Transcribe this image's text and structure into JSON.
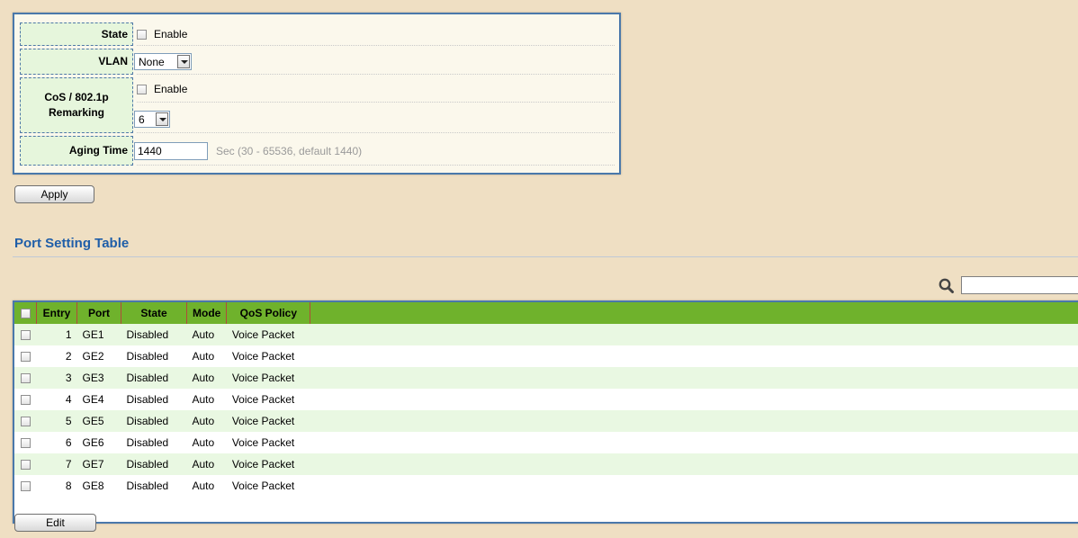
{
  "form": {
    "state": {
      "label": "State",
      "checkbox_label": "Enable"
    },
    "vlan": {
      "label": "VLAN",
      "value": "None"
    },
    "cos": {
      "label_line1": "CoS / 802.1p",
      "label_line2": "Remarking",
      "checkbox_label": "Enable",
      "value": "6"
    },
    "aging": {
      "label": "Aging Time",
      "value": "1440",
      "hint": "Sec (30 - 65536, default 1440)"
    }
  },
  "apply_button": "Apply",
  "port_table": {
    "title": "Port Setting Table",
    "search_placeholder": "",
    "columns": [
      "Entry",
      "Port",
      "State",
      "Mode",
      "QoS Policy"
    ],
    "rows": [
      {
        "entry": "1",
        "port": "GE1",
        "state": "Disabled",
        "mode": "Auto",
        "policy": "Voice Packet"
      },
      {
        "entry": "2",
        "port": "GE2",
        "state": "Disabled",
        "mode": "Auto",
        "policy": "Voice Packet"
      },
      {
        "entry": "3",
        "port": "GE3",
        "state": "Disabled",
        "mode": "Auto",
        "policy": "Voice Packet"
      },
      {
        "entry": "4",
        "port": "GE4",
        "state": "Disabled",
        "mode": "Auto",
        "policy": "Voice Packet"
      },
      {
        "entry": "5",
        "port": "GE5",
        "state": "Disabled",
        "mode": "Auto",
        "policy": "Voice Packet"
      },
      {
        "entry": "6",
        "port": "GE6",
        "state": "Disabled",
        "mode": "Auto",
        "policy": "Voice Packet"
      },
      {
        "entry": "7",
        "port": "GE7",
        "state": "Disabled",
        "mode": "Auto",
        "policy": "Voice Packet"
      },
      {
        "entry": "8",
        "port": "GE8",
        "state": "Disabled",
        "mode": "Auto",
        "policy": "Voice Packet"
      }
    ]
  },
  "edit_button": "Edit",
  "colors": {
    "background": "#efdfc3",
    "header_green": "#6fb22c",
    "title_blue": "#1f5ea8",
    "panel_border": "#4a78aa"
  }
}
